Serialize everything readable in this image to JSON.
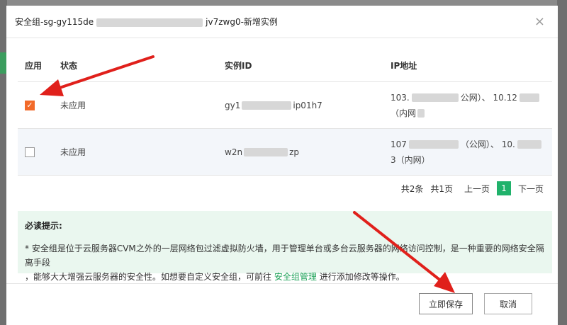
{
  "modal": {
    "title_prefix": "安全组-sg-gy115de",
    "title_suffix": "jv7zwg0-新增实例",
    "close_glyph": "×"
  },
  "table": {
    "columns": [
      "应用",
      "状态",
      "实例ID",
      "IP地址"
    ],
    "rows": [
      {
        "checked": true,
        "check_glyph": "✓",
        "status": "未应用",
        "id_prefix": "gy1",
        "id_suffix": "ip01h7",
        "ip_line1_prefix": "103.",
        "ip_line1_mid": "公网）、 10.12",
        "ip_line2": "（内网"
      },
      {
        "checked": false,
        "check_glyph": "",
        "status": "未应用",
        "id_prefix": "w2n",
        "id_suffix": "zp",
        "ip_line1_prefix": "107",
        "ip_line1_mid": "（公网）、 10.",
        "ip_line2": "3（内网）"
      }
    ]
  },
  "pager": {
    "total": "共2条",
    "pages": "共1页",
    "prev": "上一页",
    "current": "1",
    "next": "下一页"
  },
  "notice": {
    "title": "必读提示:",
    "line1": "* 安全组是位于云服务器CVM之外的一层网络包过滤虚拟防火墙，用于管理单台或多台云服务器的网络访问控制，是一种重要的网络安全隔离手段",
    "line2_before": "，能够大大增强云服务器的安全性。如想要自定义安全组，可前往",
    "link": "安全组管理",
    "line2_after": "进行添加修改等操作。"
  },
  "buttons": {
    "save": "立即保存",
    "cancel": "取消"
  },
  "colors": {
    "accent_orange": "#f26a29",
    "accent_green": "#20b26b",
    "arrow_red": "#e0201b"
  }
}
